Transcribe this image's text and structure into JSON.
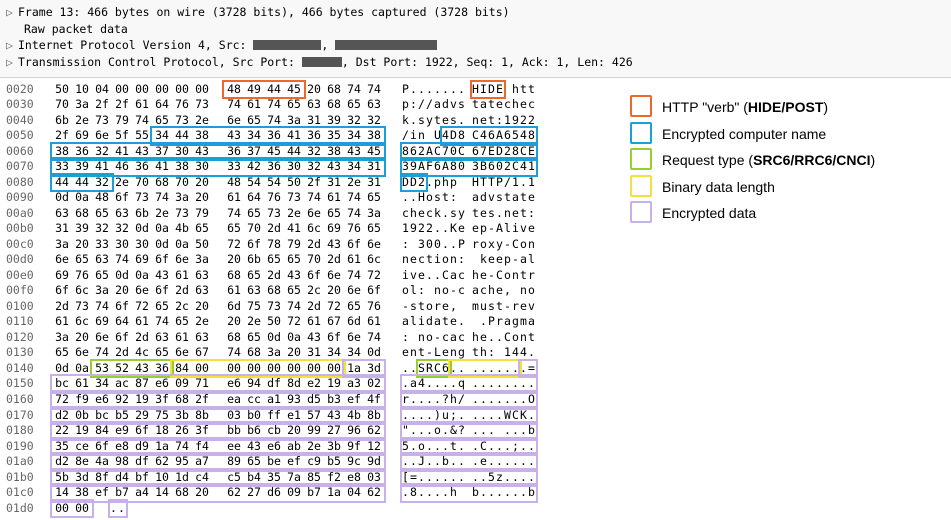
{
  "frame_summary": "Frame 13: 466 bytes on wire (3728 bits), 466 bytes captured (3728 bits)",
  "raw_packet_data": "Raw packet data",
  "ip_line_prefix": "Internet Protocol Version 4, Src: ",
  "tcp_line_prefix": "Transmission Control Protocol, Src Port: ",
  "tcp_line_suffix": ", Dst Port: 1922, Seq: 1, Ack: 1, Len: 426",
  "legend": {
    "verb": "HTTP \"verb\" (",
    "verb_em": "HIDE/POST",
    "verb_end": ")",
    "compname": "Encrypted computer name",
    "reqtype": "Request type (",
    "reqtype_em": "SRC6/RRC6/CNCI",
    "reqtype_end": ")",
    "binlen": "Binary data length",
    "encdata": "Encrypted data"
  },
  "hex": {
    "0020": {
      "off": "0020",
      "b": [
        "50",
        "10",
        "04",
        "00",
        "00",
        "00",
        "00",
        "00",
        "48",
        "49",
        "44",
        "45",
        "20",
        "68",
        "74",
        "74"
      ],
      "a": [
        "P",
        ".",
        ".",
        ".",
        ".",
        ".",
        ".",
        ".",
        "H",
        "I",
        "D",
        "E",
        " ",
        "h",
        "t",
        "t"
      ]
    },
    "0030": {
      "off": "0030",
      "b": [
        "70",
        "3a",
        "2f",
        "2f",
        "61",
        "64",
        "76",
        "73",
        "74",
        "61",
        "74",
        "65",
        "63",
        "68",
        "65",
        "63"
      ],
      "a": [
        "p",
        ":",
        "/",
        "/",
        "a",
        "d",
        "v",
        "s",
        "t",
        "a",
        "t",
        "e",
        "c",
        "h",
        "e",
        "c"
      ]
    },
    "0040": {
      "off": "0040",
      "b": [
        "6b",
        "2e",
        "73",
        "79",
        "74",
        "65",
        "73",
        "2e",
        "6e",
        "65",
        "74",
        "3a",
        "31",
        "39",
        "32",
        "32"
      ],
      "a": [
        "k",
        ".",
        "s",
        "y",
        "t",
        "e",
        "s",
        ".",
        "n",
        "e",
        "t",
        ":",
        "1",
        "9",
        "2",
        "2"
      ]
    },
    "0050": {
      "off": "0050",
      "b": [
        "2f",
        "69",
        "6e",
        "5f",
        "55",
        "34",
        "44",
        "38",
        "43",
        "34",
        "36",
        "41",
        "36",
        "35",
        "34",
        "38"
      ],
      "a": [
        "/",
        "i",
        "n",
        " ",
        "U",
        "4",
        "D",
        "8",
        "C",
        "4",
        "6",
        "A",
        "6",
        "5",
        "4",
        "8"
      ]
    },
    "0060": {
      "off": "0060",
      "b": [
        "38",
        "36",
        "32",
        "41",
        "43",
        "37",
        "30",
        "43",
        "36",
        "37",
        "45",
        "44",
        "32",
        "38",
        "43",
        "45"
      ],
      "a": [
        "8",
        "6",
        "2",
        "A",
        "C",
        "7",
        "0",
        "C",
        "6",
        "7",
        "E",
        "D",
        "2",
        "8",
        "C",
        "E"
      ]
    },
    "0070": {
      "off": "0070",
      "b": [
        "33",
        "39",
        "41",
        "46",
        "36",
        "41",
        "38",
        "30",
        "33",
        "42",
        "36",
        "30",
        "32",
        "43",
        "34",
        "31"
      ],
      "a": [
        "3",
        "9",
        "A",
        "F",
        "6",
        "A",
        "8",
        "0",
        "3",
        "B",
        "6",
        "0",
        "2",
        "C",
        "4",
        "1"
      ]
    },
    "0080": {
      "off": "0080",
      "b": [
        "44",
        "44",
        "32",
        "2e",
        "70",
        "68",
        "70",
        "20",
        "48",
        "54",
        "54",
        "50",
        "2f",
        "31",
        "2e",
        "31"
      ],
      "a": [
        "D",
        "D",
        "2",
        ".",
        "p",
        "h",
        "p",
        " ",
        "H",
        "T",
        "T",
        "P",
        "/",
        "1",
        ".",
        "1"
      ]
    },
    "0090": {
      "off": "0090",
      "b": [
        "0d",
        "0a",
        "48",
        "6f",
        "73",
        "74",
        "3a",
        "20",
        "61",
        "64",
        "76",
        "73",
        "74",
        "61",
        "74",
        "65"
      ],
      "a": [
        ".",
        ".",
        "H",
        "o",
        "s",
        "t",
        ":",
        " ",
        "a",
        "d",
        "v",
        "s",
        "t",
        "a",
        "t",
        "e"
      ]
    },
    "00a0": {
      "off": "00a0",
      "b": [
        "63",
        "68",
        "65",
        "63",
        "6b",
        "2e",
        "73",
        "79",
        "74",
        "65",
        "73",
        "2e",
        "6e",
        "65",
        "74",
        "3a"
      ],
      "a": [
        "c",
        "h",
        "e",
        "c",
        "k",
        ".",
        "s",
        "y",
        "t",
        "e",
        "s",
        ".",
        "n",
        "e",
        "t",
        ":"
      ]
    },
    "00b0": {
      "off": "00b0",
      "b": [
        "31",
        "39",
        "32",
        "32",
        "0d",
        "0a",
        "4b",
        "65",
        "65",
        "70",
        "2d",
        "41",
        "6c",
        "69",
        "76",
        "65"
      ],
      "a": [
        "1",
        "9",
        "2",
        "2",
        ".",
        ".",
        "K",
        "e",
        "e",
        "p",
        "-",
        "A",
        "l",
        "i",
        "v",
        "e"
      ]
    },
    "00c0": {
      "off": "00c0",
      "b": [
        "3a",
        "20",
        "33",
        "30",
        "30",
        "0d",
        "0a",
        "50",
        "72",
        "6f",
        "78",
        "79",
        "2d",
        "43",
        "6f",
        "6e"
      ],
      "a": [
        ":",
        " ",
        "3",
        "0",
        "0",
        ".",
        ".",
        "P",
        "r",
        "o",
        "x",
        "y",
        "-",
        "C",
        "o",
        "n"
      ]
    },
    "00d0": {
      "off": "00d0",
      "b": [
        "6e",
        "65",
        "63",
        "74",
        "69",
        "6f",
        "6e",
        "3a",
        "20",
        "6b",
        "65",
        "65",
        "70",
        "2d",
        "61",
        "6c"
      ],
      "a": [
        "n",
        "e",
        "c",
        "t",
        "i",
        "o",
        "n",
        ":",
        " ",
        "k",
        "e",
        "e",
        "p",
        "-",
        "a",
        "l"
      ]
    },
    "00e0": {
      "off": "00e0",
      "b": [
        "69",
        "76",
        "65",
        "0d",
        "0a",
        "43",
        "61",
        "63",
        "68",
        "65",
        "2d",
        "43",
        "6f",
        "6e",
        "74",
        "72"
      ],
      "a": [
        "i",
        "v",
        "e",
        ".",
        ".",
        "C",
        "a",
        "c",
        "h",
        "e",
        "-",
        "C",
        "o",
        "n",
        "t",
        "r"
      ]
    },
    "00f0": {
      "off": "00f0",
      "b": [
        "6f",
        "6c",
        "3a",
        "20",
        "6e",
        "6f",
        "2d",
        "63",
        "61",
        "63",
        "68",
        "65",
        "2c",
        "20",
        "6e",
        "6f"
      ],
      "a": [
        "o",
        "l",
        ":",
        " ",
        "n",
        "o",
        "-",
        "c",
        "a",
        "c",
        "h",
        "e",
        ",",
        " ",
        "n",
        "o"
      ]
    },
    "0100": {
      "off": "0100",
      "b": [
        "2d",
        "73",
        "74",
        "6f",
        "72",
        "65",
        "2c",
        "20",
        "6d",
        "75",
        "73",
        "74",
        "2d",
        "72",
        "65",
        "76"
      ],
      "a": [
        "-",
        "s",
        "t",
        "o",
        "r",
        "e",
        ",",
        " ",
        "m",
        "u",
        "s",
        "t",
        "-",
        "r",
        "e",
        "v"
      ]
    },
    "0110": {
      "off": "0110",
      "b": [
        "61",
        "6c",
        "69",
        "64",
        "61",
        "74",
        "65",
        "2e",
        "20",
        "2e",
        "50",
        "72",
        "61",
        "67",
        "6d",
        "61"
      ],
      "a": [
        "a",
        "l",
        "i",
        "d",
        "a",
        "t",
        "e",
        ".",
        " ",
        ".",
        "P",
        "r",
        "a",
        "g",
        "m",
        "a"
      ]
    },
    "0120": {
      "off": "0120",
      "b": [
        "3a",
        "20",
        "6e",
        "6f",
        "2d",
        "63",
        "61",
        "63",
        "68",
        "65",
        "0d",
        "0a",
        "43",
        "6f",
        "6e",
        "74"
      ],
      "a": [
        ":",
        " ",
        "n",
        "o",
        "-",
        "c",
        "a",
        "c",
        "h",
        "e",
        ".",
        ".",
        "C",
        "o",
        "n",
        "t"
      ]
    },
    "0130": {
      "off": "0130",
      "b": [
        "65",
        "6e",
        "74",
        "2d",
        "4c",
        "65",
        "6e",
        "67",
        "74",
        "68",
        "3a",
        "20",
        "31",
        "34",
        "34",
        "0d"
      ],
      "a": [
        "e",
        "n",
        "t",
        "-",
        "L",
        "e",
        "n",
        "g",
        "t",
        "h",
        ":",
        " ",
        "1",
        "4",
        "4",
        "."
      ]
    },
    "0140": {
      "off": "0140",
      "b": [
        "0d",
        "0a",
        "53",
        "52",
        "43",
        "36",
        "84",
        "00",
        "00",
        "00",
        "00",
        "00",
        "00",
        "00",
        "1a",
        "3d"
      ],
      "a": [
        ".",
        ".",
        "S",
        "R",
        "C",
        "6",
        ".",
        ".",
        ".",
        ".",
        ".",
        ".",
        ".",
        ".",
        ".",
        "="
      ]
    },
    "0150": {
      "off": "0150",
      "b": [
        "bc",
        "61",
        "34",
        "ac",
        "87",
        "e6",
        "09",
        "71",
        "e6",
        "94",
        "df",
        "8d",
        "e2",
        "19",
        "a3",
        "02"
      ],
      "a": [
        ".",
        "a",
        "4",
        ".",
        ".",
        ".",
        ".",
        "q",
        ".",
        ".",
        ".",
        ".",
        ".",
        ".",
        ".",
        "."
      ]
    },
    "0160": {
      "off": "0160",
      "b": [
        "72",
        "f9",
        "e6",
        "92",
        "19",
        "3f",
        "68",
        "2f",
        "ea",
        "cc",
        "a1",
        "93",
        "d5",
        "b3",
        "ef",
        "4f"
      ],
      "a": [
        "r",
        ".",
        ".",
        ".",
        ".",
        "?",
        "h",
        "/",
        ".",
        ".",
        ".",
        ".",
        ".",
        ".",
        ".",
        "O"
      ]
    },
    "0170": {
      "off": "0170",
      "b": [
        "d2",
        "0b",
        "bc",
        "b5",
        "29",
        "75",
        "3b",
        "8b",
        "03",
        "b0",
        "ff",
        "e1",
        "57",
        "43",
        "4b",
        "8b"
      ],
      "a": [
        ".",
        ".",
        ".",
        ".",
        ")",
        "u",
        ";",
        ".",
        ".",
        ".",
        ".",
        ".",
        "W",
        "C",
        "K",
        "."
      ]
    },
    "0180": {
      "off": "0180",
      "b": [
        "22",
        "19",
        "84",
        "e9",
        "6f",
        "18",
        "26",
        "3f",
        "bb",
        "b6",
        "cb",
        "20",
        "99",
        "27",
        "96",
        "62"
      ],
      "a": [
        "\"",
        ".",
        ".",
        ".",
        "o",
        ".",
        "&",
        "?",
        ".",
        ".",
        ".",
        " ",
        ".",
        ".",
        ".",
        "b"
      ]
    },
    "0190": {
      "off": "0190",
      "b": [
        "35",
        "ce",
        "6f",
        "e8",
        "d9",
        "1a",
        "74",
        "f4",
        "ee",
        "43",
        "e6",
        "ab",
        "2e",
        "3b",
        "9f",
        "12"
      ],
      "a": [
        "5",
        ".",
        "o",
        ".",
        ".",
        ".",
        "t",
        ".",
        ".",
        "C",
        ".",
        ".",
        ".",
        ";",
        ".",
        "."
      ]
    },
    "01a0": {
      "off": "01a0",
      "b": [
        "d2",
        "8e",
        "4a",
        "98",
        "df",
        "62",
        "95",
        "a7",
        "89",
        "65",
        "be",
        "ef",
        "c9",
        "b5",
        "9c",
        "9d"
      ],
      "a": [
        ".",
        ".",
        "J",
        ".",
        ".",
        "b",
        ".",
        ".",
        ".",
        "e",
        ".",
        ".",
        ".",
        ".",
        ".",
        "."
      ]
    },
    "01b0": {
      "off": "01b0",
      "b": [
        "5b",
        "3d",
        "8f",
        "d4",
        "bf",
        "10",
        "1d",
        "c4",
        "c5",
        "b4",
        "35",
        "7a",
        "85",
        "f2",
        "e8",
        "03"
      ],
      "a": [
        "[",
        "=",
        ".",
        ".",
        ".",
        ".",
        ".",
        ".",
        ".",
        ".",
        "5",
        "z",
        ".",
        ".",
        ".",
        "."
      ]
    },
    "01c0": {
      "off": "01c0",
      "b": [
        "14",
        "38",
        "ef",
        "b7",
        "a4",
        "14",
        "68",
        "20",
        "62",
        "27",
        "d6",
        "09",
        "b7",
        "1a",
        "04",
        "62"
      ],
      "a": [
        ".",
        "8",
        ".",
        ".",
        ".",
        ".",
        "h",
        " ",
        "b",
        ".",
        ".",
        ".",
        ".",
        ".",
        ".",
        "b"
      ]
    },
    "01d0": {
      "off": "01d0",
      "b": [
        "00",
        "00"
      ],
      "a": [
        ".",
        "."
      ]
    }
  }
}
